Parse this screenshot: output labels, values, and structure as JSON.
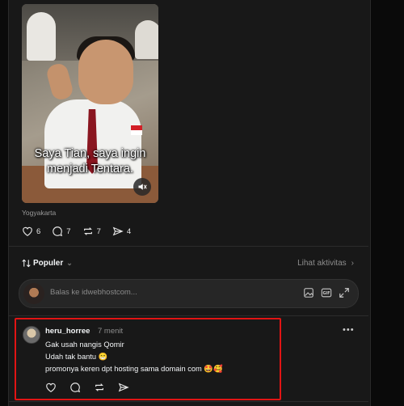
{
  "post": {
    "video_caption_line1": "Saya Tian, saya ingin",
    "video_caption_line2": "menjadi Tentara.",
    "location": "Yogyakarta",
    "likes": "6",
    "comments": "7",
    "reposts": "7",
    "shares": "4"
  },
  "replies": {
    "sort_label": "Populer",
    "activity_label": "Lihat aktivitas",
    "reply_placeholder": "Balas ke idwebhostcom..."
  },
  "comment": {
    "username": "heru_horree",
    "time": "7 menit",
    "line1": "Gak usah nangis Qomir",
    "line2": "Udah tak bantu 😁",
    "line3": "promonya keren dpt hosting sama domain com 🤩🥰"
  },
  "colors": {
    "highlight_border": "#e11414",
    "background": "#181818"
  }
}
